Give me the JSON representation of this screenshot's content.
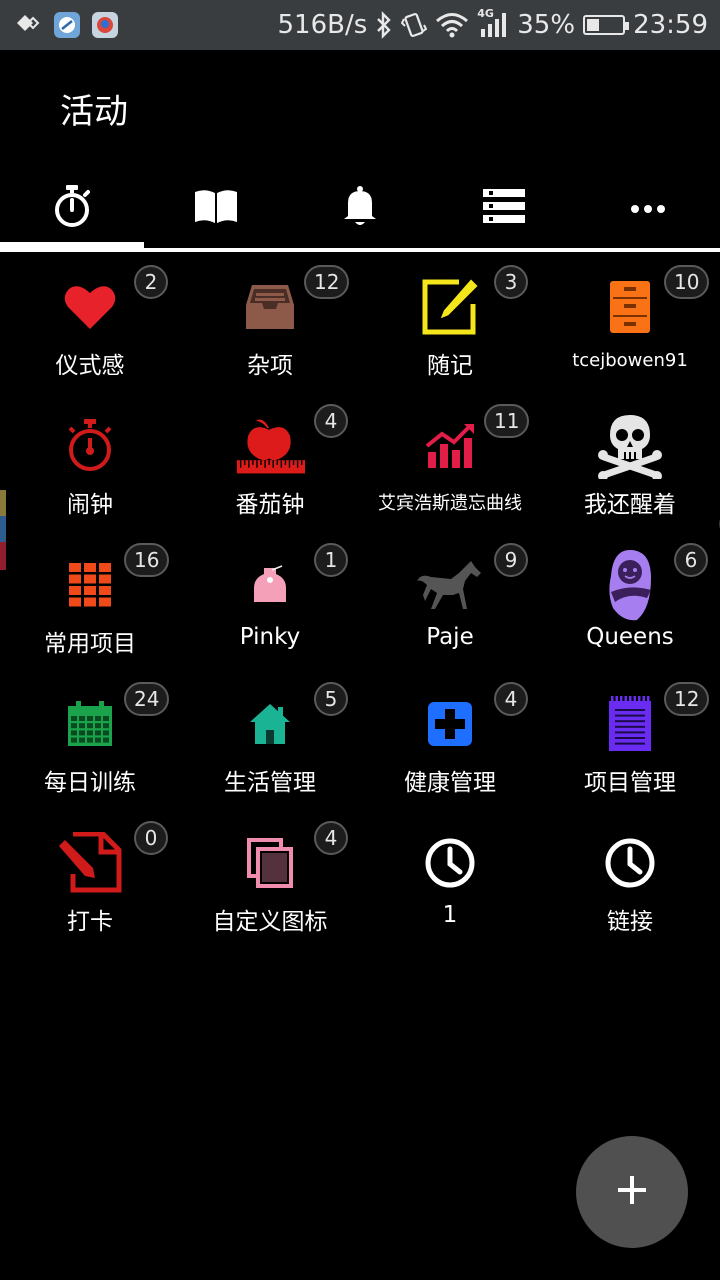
{
  "status_bar": {
    "net_speed": "516B/s",
    "network_type": "4G",
    "battery_percent": "35%",
    "battery_level": 0.35,
    "time": "23:59",
    "icons": [
      "assistant-icon",
      "app-icon-1",
      "app-icon-2",
      "bluetooth-icon",
      "vibrate-icon",
      "wifi-icon",
      "signal-icon",
      "battery-icon"
    ]
  },
  "header": {
    "title": "活动"
  },
  "tabs": [
    {
      "icon": "timer-icon"
    },
    {
      "icon": "book-icon"
    },
    {
      "icon": "bell-icon"
    },
    {
      "icon": "list-icon"
    },
    {
      "icon": "more-icon"
    }
  ],
  "activities": [
    {
      "label": "仪式感",
      "count": "2",
      "icon": "heart-icon",
      "color": "#e8222b"
    },
    {
      "label": "杂项",
      "count": "12",
      "icon": "inbox-tray-icon",
      "color": "#8d5a4a"
    },
    {
      "label": "随记",
      "count": "3",
      "icon": "edit-icon",
      "color": "#f5e61b"
    },
    {
      "label": "tcejbowen91",
      "count": "10",
      "icon": "cabinet-icon",
      "color": "#f97316"
    },
    {
      "label": "闹钟",
      "count": "",
      "icon": "stopwatch-icon",
      "color": "#d11a1a"
    },
    {
      "label": "番茄钟",
      "count": "4",
      "icon": "apple-ruler-icon",
      "color": "#dd1b1b"
    },
    {
      "label": "艾宾浩斯遗忘曲线",
      "count": "11",
      "icon": "trend-chart-icon",
      "color": "#e11d48"
    },
    {
      "label": "我还醒着",
      "count": "",
      "icon": "skull-icon",
      "color": "#e5e5e5"
    },
    {
      "label": "常用项目",
      "count": "16",
      "icon": "grid-icon",
      "color": "#f04a1a"
    },
    {
      "label": "Pinky",
      "count": "1",
      "icon": "tag-icon",
      "color": "#f3a0b8"
    },
    {
      "label": "Paje",
      "count": "9",
      "icon": "horse-icon",
      "color": "#555555"
    },
    {
      "label": "Queens",
      "count": "6",
      "icon": "baby-icon",
      "color": "#a77ef0"
    },
    {
      "label": "每日训练",
      "count": "24",
      "icon": "calendar-icon",
      "color": "#1aa34a"
    },
    {
      "label": "生活管理",
      "count": "5",
      "icon": "home-icon",
      "color": "#1ab394"
    },
    {
      "label": "健康管理",
      "count": "4",
      "icon": "medical-plus-icon",
      "color": "#1e6fff"
    },
    {
      "label": "项目管理",
      "count": "12",
      "icon": "notepad-icon",
      "color": "#6a2cf0"
    },
    {
      "label": "打卡",
      "count": "0",
      "icon": "document-edit-icon",
      "color": "#d11a1a"
    },
    {
      "label": "自定义图标",
      "count": "4",
      "icon": "copy-icon",
      "color": "#f08cad"
    },
    {
      "label": "1",
      "count": "",
      "icon": "clock-icon",
      "color": "#ffffff"
    },
    {
      "label": "链接",
      "count": "",
      "icon": "clock-icon",
      "color": "#ffffff"
    }
  ],
  "fab": {
    "icon": "plus-icon"
  }
}
